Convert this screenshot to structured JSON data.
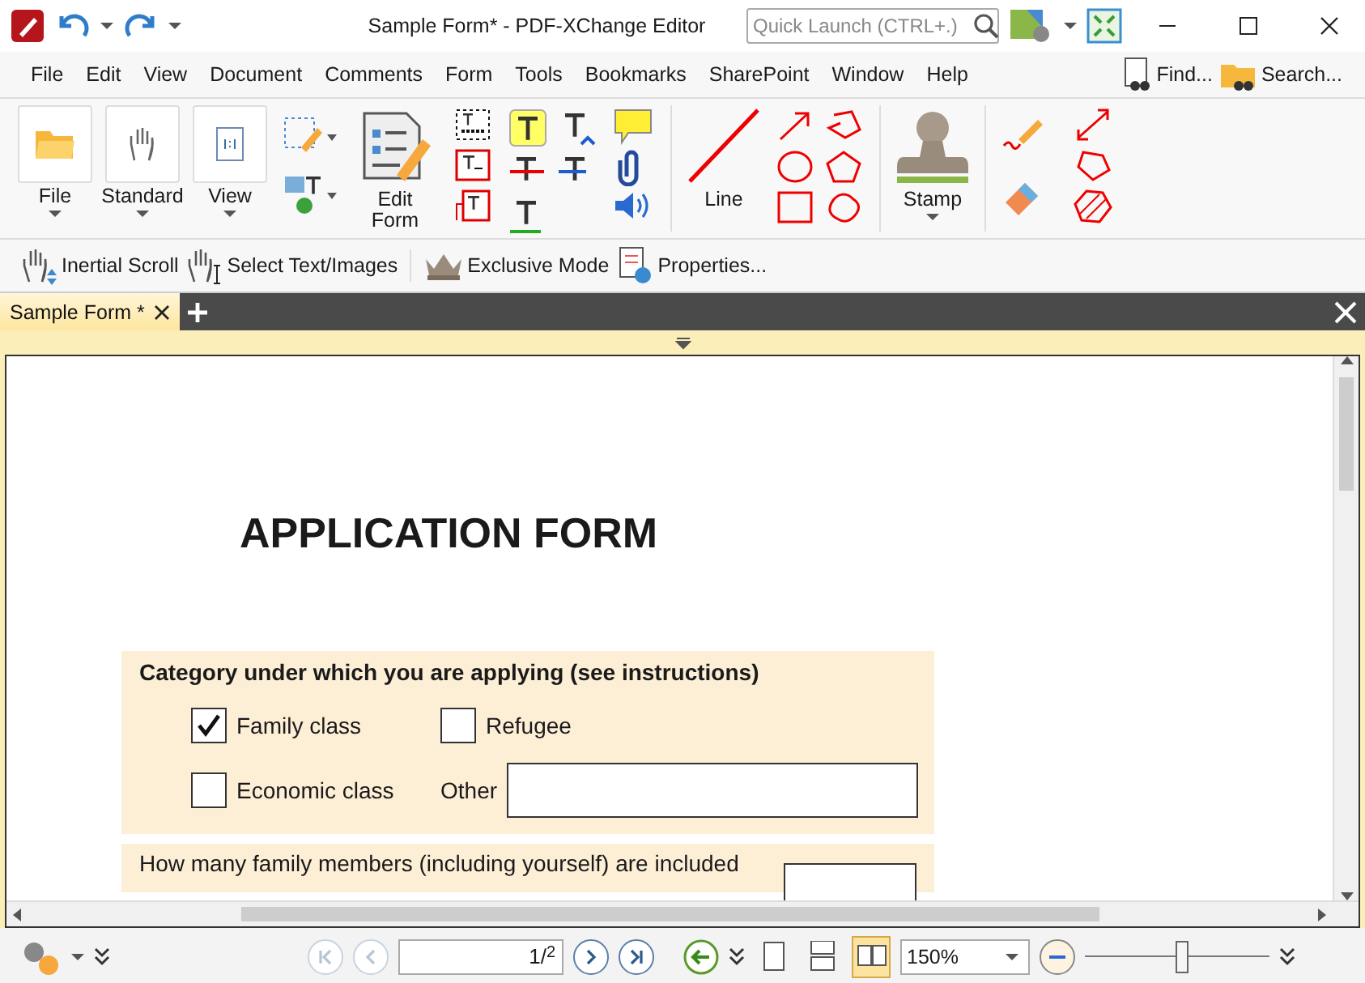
{
  "window": {
    "title": "Sample Form* - PDF-XChange Editor",
    "quick_launch": {
      "placeholder": "Quick Launch (CTRL+.)"
    }
  },
  "menu": [
    "File",
    "Edit",
    "View",
    "Document",
    "Comments",
    "Form",
    "Tools",
    "Bookmarks",
    "SharePoint",
    "Window",
    "Help"
  ],
  "menu_right": [
    "Find...",
    "Search..."
  ],
  "ribbon": {
    "file": "File",
    "standard": "Standard",
    "view": "View",
    "edit_form": "Edit Form",
    "line": "Line",
    "stamp": "Stamp"
  },
  "toolbar": [
    "Inertial Scroll",
    "Select Text/Images",
    "Exclusive Mode",
    "Properties..."
  ],
  "tabs": [
    {
      "label": "Sample Form *",
      "selected": true
    }
  ],
  "document": {
    "title": "APPLICATION FORM",
    "section_heading": "Category under which you are applying (see instructions)",
    "options": [
      {
        "kind": "checkbox",
        "label": "Family class",
        "checked": true
      },
      {
        "kind": "checkbox",
        "label": "Refugee",
        "checked": false
      },
      {
        "kind": "checkbox",
        "label": "Economic class",
        "checked": false
      },
      {
        "kind": "field",
        "label": "Other"
      }
    ],
    "next_question": "How many family members (including yourself) are included"
  },
  "status_bar": {
    "nav": [
      {
        "kind": "first",
        "disabled": true
      },
      {
        "kind": "prev",
        "disabled": true
      }
    ],
    "page": "1",
    "page_separator": "/",
    "page_total": "2",
    "nav_after": [
      {
        "kind": "next",
        "disabled": false
      },
      {
        "kind": "last",
        "disabled": false
      }
    ],
    "view_modes": [
      {
        "kind": "single",
        "selected": false
      },
      {
        "kind": "continuous",
        "selected": false
      },
      {
        "kind": "two",
        "selected": true
      }
    ],
    "zoom": "150%",
    "zoom_slider": {
      "level": 0.53
    }
  }
}
